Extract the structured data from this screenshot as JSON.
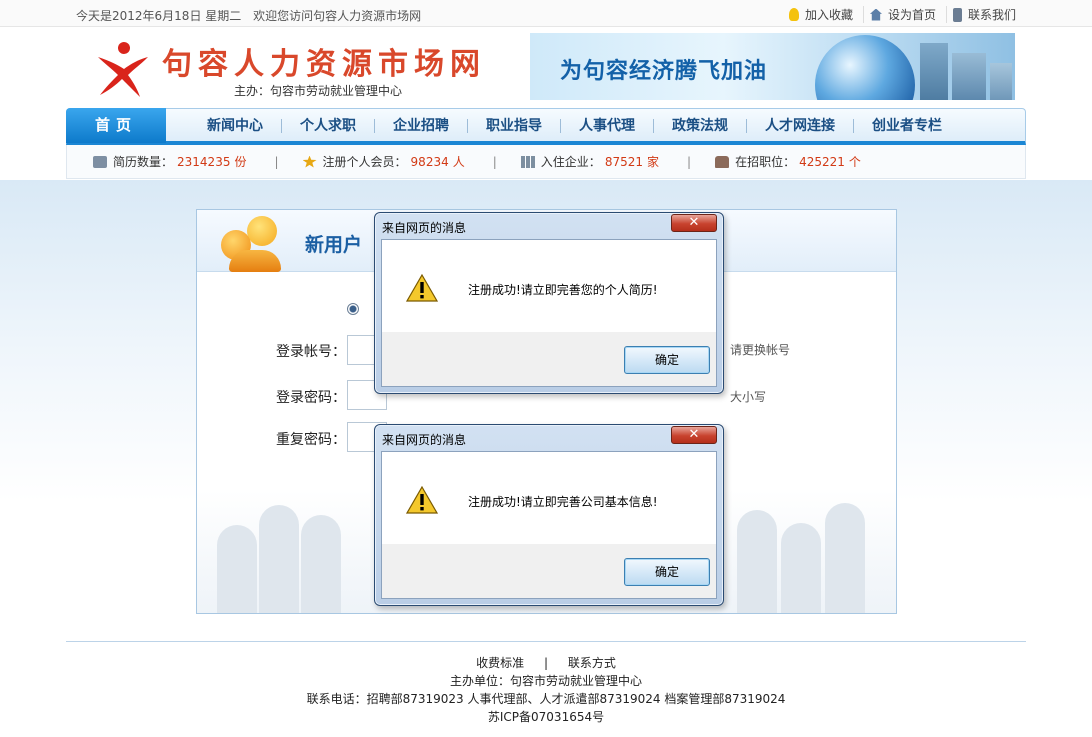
{
  "topbar": {
    "date": "今天是2012年6月18日 星期二",
    "welcome": "欢迎您访问句容人力资源市场网",
    "links": [
      {
        "label": "加入收藏",
        "icon": "bulb-icon"
      },
      {
        "label": "设为首页",
        "icon": "home-icon"
      },
      {
        "label": "联系我们",
        "icon": "phone-icon"
      }
    ]
  },
  "header": {
    "site_title": "句容人力资源市场网",
    "sponsor": "主办：句容市劳动就业管理中心",
    "banner_text": "为句容经济腾飞加油"
  },
  "nav": {
    "home": "首页",
    "items": [
      "新闻中心",
      "个人求职",
      "企业招聘",
      "职业指导",
      "人事代理",
      "政策法规",
      "人才网连接",
      "创业者专栏"
    ]
  },
  "stats": [
    {
      "label": "简历数量：",
      "value": "2314235",
      "unit": "份",
      "icon": "resume-icon"
    },
    {
      "label": "注册个人会员：",
      "value": "98234",
      "unit": "人",
      "icon": "star-icon"
    },
    {
      "label": "入住企业：",
      "value": "87521",
      "unit": "家",
      "icon": "building-icon"
    },
    {
      "label": "在招职位：",
      "value": "425221",
      "unit": "个",
      "icon": "shirt-icon"
    }
  ],
  "panel": {
    "title": "新用户",
    "fields": [
      {
        "label": "登录帐号：",
        "hint": "请更换帐号"
      },
      {
        "label": "登录密码：",
        "hint": "大小写"
      },
      {
        "label": "重复密码：",
        "hint": ""
      }
    ]
  },
  "dialogs": [
    {
      "title": "来自网页的消息",
      "message": "注册成功!请立即完善您的个人简历!",
      "ok": "确定",
      "close": "✕"
    },
    {
      "title": "来自网页的消息",
      "message": "注册成功!请立即完善公司基本信息!",
      "ok": "确定",
      "close": "✕"
    }
  ],
  "footer": {
    "links": [
      "收费标准",
      "联系方式"
    ],
    "separator": "|",
    "host": "主办单位：句容市劳动就业管理中心",
    "phones": "联系电话：招聘部87319023   人事代理部、人才派遣部87319024   档案管理部87319024",
    "icp": "苏ICP备07031654号"
  },
  "colors": {
    "accent": "#1b86d4",
    "stat_number": "#d23a15",
    "logo": "#d9482b"
  }
}
